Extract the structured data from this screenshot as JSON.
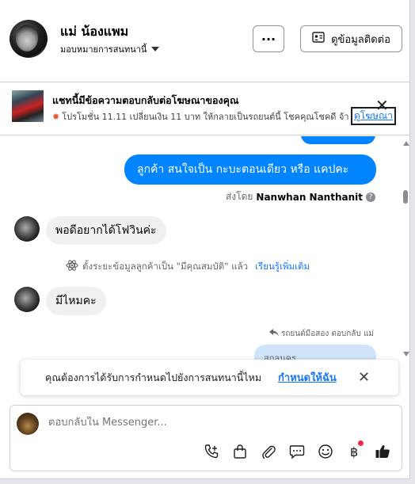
{
  "header": {
    "contact_name": "แม่ น้องแพม",
    "assign_label": "มอบหมายการสนทนานี้",
    "more_label": "···",
    "info_button_label": "ดูข้อมูลติดต่อ"
  },
  "ad": {
    "title": "แชทนี้มีข้อความตอบกลับต่อโฆษณาของคุณ",
    "description": "โปรโมชั่น 11.11 เปลี่ยนเงิน 11 บาท ให้กลายเป็นรถยนต์นี้ โชคคุณโชคดี จ้า",
    "view_link": "ดูโฆษณา"
  },
  "messages": {
    "outgoing_1": "ลูกค้า สนใจเป็น กะบะตอนเดียว  หรือ  แคปคะ",
    "sent_by_prefix": "ส่งโดย",
    "sent_by_name": "Nanwhan Nanthanit",
    "incoming_1": "พอดีอยากได้โฟวินค่ะ",
    "note_text": "ตั้งระยะข้อมูลลูกค้าเป็น \"มีคุณสมบัติ\" แล้ว",
    "note_link": "เรียนรู้เพิ่มเติม",
    "incoming_2": "มีไหมคะ",
    "reply_meta": "รถยนต์มือสอง ตอบกลับ แม่",
    "quoted_text": "สกลนคร"
  },
  "toast": {
    "question": "คุณต้องการได้รับการกำหนดไปยังการสนทนานี้ไหม",
    "action": "กำหนดให้ฉัน"
  },
  "composer": {
    "placeholder": "ตอบกลับใน Messenger..."
  },
  "colors": {
    "accent": "#0084ff",
    "link": "#1877f2",
    "incoming_bubble": "#f0f0f0",
    "notification_dot": "#f02849"
  }
}
